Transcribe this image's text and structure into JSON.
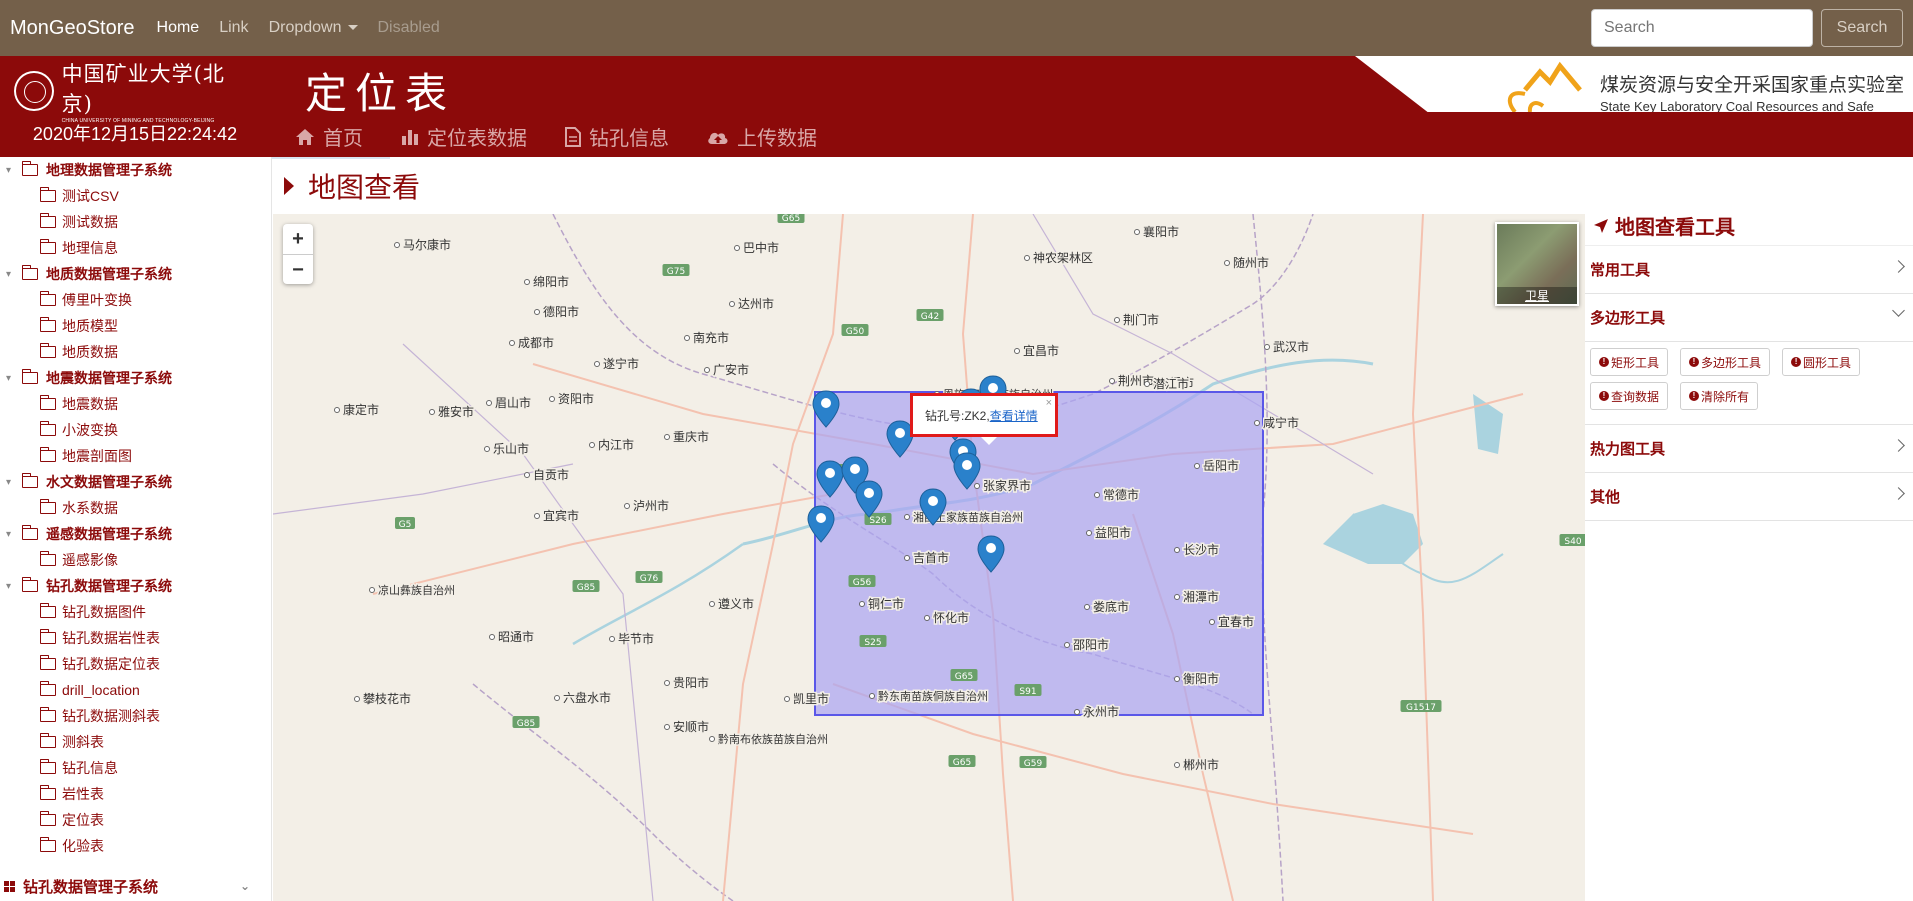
{
  "navbar": {
    "brand": "MonGeoStore",
    "links": [
      "Home",
      "Link",
      "Dropdown",
      "Disabled"
    ],
    "search_placeholder": "Search",
    "search_button": "Search"
  },
  "header": {
    "university_cn": "中国矿业大学(北京)",
    "university_en": "CHINA UNIVERSITY OF MINING AND TECHNOLOGY-BEIJING",
    "title": "定位表",
    "datetime": "2020年12月15日22:24:42",
    "menu": [
      {
        "label": "首页",
        "icon": "home-icon"
      },
      {
        "label": "定位表数据",
        "icon": "bar-chart-icon"
      },
      {
        "label": "钻孔信息",
        "icon": "document-icon"
      },
      {
        "label": "上传数据",
        "icon": "cloud-upload-icon"
      }
    ],
    "lab_cn": "煤炭资源与安全开采国家重点实验室",
    "lab_en": "State Key Laboratory Coal Resources and Safe Mining"
  },
  "sidebar": {
    "groups": [
      {
        "label": "地理数据管理子系统",
        "items": [
          "测试CSV",
          "测试数据",
          "地理信息"
        ]
      },
      {
        "label": "地质数据管理子系统",
        "items": [
          "傅里叶变换",
          "地质模型",
          "地质数据"
        ]
      },
      {
        "label": "地震数据管理子系统",
        "items": [
          "地震数据",
          "小波变换",
          "地震剖面图"
        ]
      },
      {
        "label": "水文数据管理子系统",
        "items": [
          "水系数据"
        ]
      },
      {
        "label": "遥感数据管理子系统",
        "items": [
          "遥感影像"
        ]
      },
      {
        "label": "钻孔数据管理子系统",
        "items": [
          "钻孔数据图件",
          "钻孔数据岩性表",
          "钻孔数据定位表",
          "drill_location",
          "钻孔数据测斜表",
          "测斜表",
          "钻孔信息",
          "岩性表",
          "定位表",
          "化验表"
        ]
      }
    ],
    "footer": "钻孔数据管理子系统"
  },
  "main": {
    "title": "地图查看"
  },
  "map": {
    "zoom_in": "+",
    "zoom_out": "−",
    "satellite_label": "卫星",
    "popup_text": "钻孔号:ZK2,",
    "popup_link": "查看详情",
    "popup_close": "×",
    "cities": [
      "马尔康市",
      "巴中市",
      "神农架林区",
      "襄阳市",
      "随州市",
      "绵阳市",
      "达州市",
      "德阳市",
      "南充市",
      "荆门市",
      "成都市",
      "广安市",
      "宜昌市",
      "遂宁市",
      "恩施土家族苗族自治州",
      "天门市",
      "武汉市",
      "康定市",
      "雅安市",
      "眉山市",
      "资阳市",
      "荆州市",
      "潜江市",
      "乐山市",
      "内江市",
      "重庆市",
      "咸宁市",
      "自贡市",
      "张家界市",
      "常德市",
      "岳阳市",
      "泸州市",
      "宜宾市",
      "湘西土家族苗族自治州",
      "益阳市",
      "长沙市",
      "吉首市",
      "凉山彝族自治州",
      "遵义市",
      "铜仁市",
      "怀化市",
      "娄底市",
      "湘潭市",
      "宜春市",
      "昭通市",
      "毕节市",
      "邵阳市",
      "衡阳市",
      "贵阳市",
      "攀枝花市",
      "六盘水市",
      "凯里市",
      "黔东南苗族侗族自治州",
      "永州市",
      "安顺市",
      "黔南布依族苗族自治州",
      "郴州市"
    ],
    "highways": [
      "G65",
      "G75",
      "G42",
      "G50",
      "G65",
      "S26",
      "G5",
      "G85",
      "G76",
      "G56",
      "S25",
      "G65",
      "S91",
      "G1517",
      "G85",
      "G65",
      "G59",
      "S40"
    ],
    "markers_count": 13
  },
  "tools": {
    "title": "地图查看工具",
    "sections": [
      "常用工具",
      "多边形工具",
      "热力图工具",
      "其他"
    ],
    "polygon_buttons": [
      "矩形工具",
      "多边形工具",
      "圆形工具",
      "查询数据",
      "清除所有"
    ]
  },
  "colors": {
    "brand_red": "#8c0a0a",
    "navbar_bg": "#74604a",
    "selection_fill": "#a9a4f2",
    "marker_blue": "#2a81cb",
    "popup_border": "#e01a1a"
  }
}
